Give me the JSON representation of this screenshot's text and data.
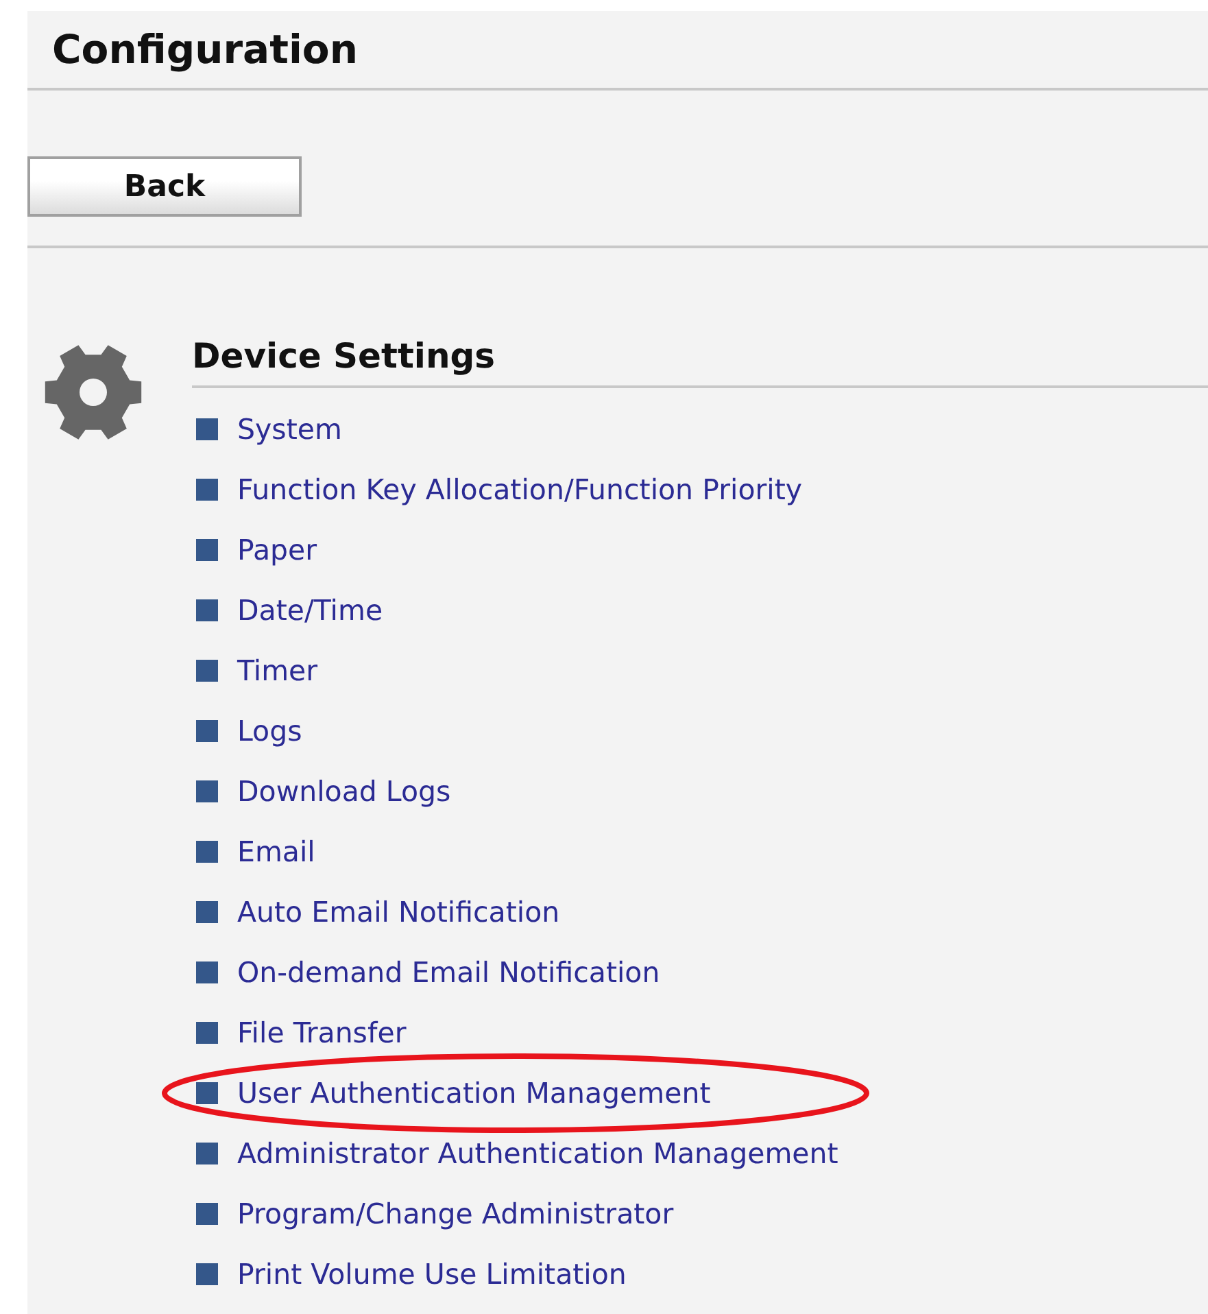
{
  "page_title": "Configuration",
  "back_button": "Back",
  "section": {
    "title": "Device Settings",
    "items": [
      {
        "label": "System",
        "highlighted": false
      },
      {
        "label": "Function Key Allocation/Function Priority",
        "highlighted": false
      },
      {
        "label": "Paper",
        "highlighted": false
      },
      {
        "label": "Date/Time",
        "highlighted": false
      },
      {
        "label": "Timer",
        "highlighted": false
      },
      {
        "label": "Logs",
        "highlighted": false
      },
      {
        "label": "Download Logs",
        "highlighted": false
      },
      {
        "label": "Email",
        "highlighted": false
      },
      {
        "label": "Auto Email Notification",
        "highlighted": false
      },
      {
        "label": "On-demand Email Notification",
        "highlighted": false
      },
      {
        "label": "File Transfer",
        "highlighted": false
      },
      {
        "label": "User Authentication Management",
        "highlighted": true
      },
      {
        "label": "Administrator Authentication Management",
        "highlighted": false
      },
      {
        "label": "Program/Change Administrator",
        "highlighted": false
      },
      {
        "label": "Print Volume Use Limitation",
        "highlighted": false
      }
    ]
  }
}
